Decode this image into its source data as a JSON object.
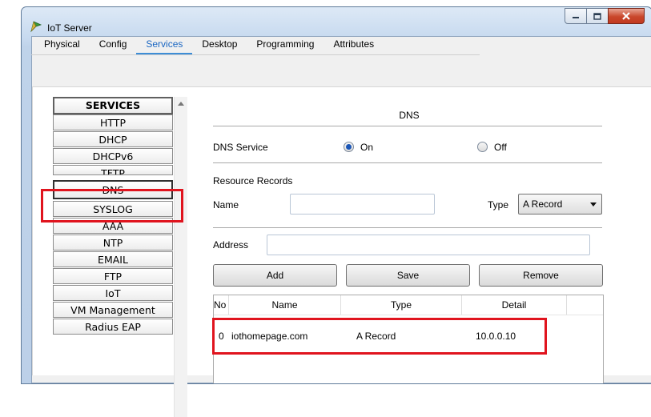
{
  "window": {
    "title": "IoT Server",
    "controls": [
      "minimize",
      "maximize",
      "close"
    ]
  },
  "tabs": [
    {
      "label": "Physical",
      "active": false
    },
    {
      "label": "Config",
      "active": false
    },
    {
      "label": "Services",
      "active": true
    },
    {
      "label": "Desktop",
      "active": false
    },
    {
      "label": "Programming",
      "active": false
    },
    {
      "label": "Attributes",
      "active": false
    }
  ],
  "services": {
    "header": "SERVICES",
    "items": [
      "HTTP",
      "DHCP",
      "DHCPv6",
      "TFTP",
      "DNS",
      "SYSLOG",
      "AAA",
      "NTP",
      "EMAIL",
      "FTP",
      "IoT",
      "VM Management",
      "Radius EAP"
    ],
    "selected": "DNS"
  },
  "dns": {
    "title": "DNS",
    "service_label": "DNS Service",
    "on_label": "On",
    "off_label": "Off",
    "service_state": "On",
    "resource_records_label": "Resource Records",
    "name_label": "Name",
    "name_value": "",
    "type_label": "Type",
    "type_value": "A Record",
    "address_label": "Address",
    "address_value": "",
    "buttons": {
      "add": "Add",
      "save": "Save",
      "remove": "Remove"
    },
    "table": {
      "columns": [
        "No",
        "Name",
        "Type",
        "Detail"
      ],
      "rows": [
        {
          "no": "0",
          "name": "iothomepage.com",
          "type": "A Record",
          "detail": "10.0.0.10"
        }
      ]
    }
  },
  "colors": {
    "accent": "#1a66c2",
    "highlight": "#e0141e"
  }
}
